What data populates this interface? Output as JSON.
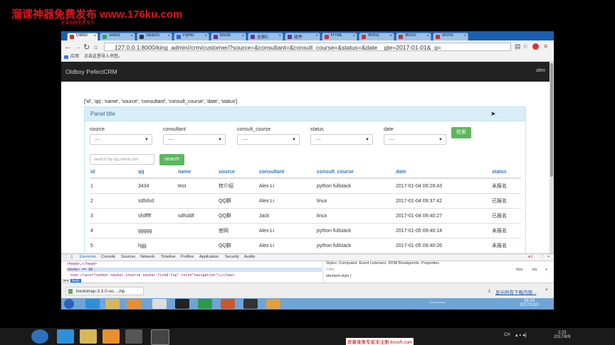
{
  "watermark": {
    "title": "溜课神器免费发布 www.176ku.com",
    "sub": "溜课神器免费发布"
  },
  "browser": {
    "tabs": [
      {
        "label": "Oldbo",
        "active": true
      },
      {
        "label": "select"
      },
      {
        "label": "Search"
      },
      {
        "label": "Pytho"
      },
      {
        "label": "Boots"
      },
      {
        "label": "全部C"
      },
      {
        "label": "组件"
      },
      {
        "label": "HTML"
      },
      {
        "label": "W3Sc"
      },
      {
        "label": "W3Sc"
      },
      {
        "label": "W3Sc"
      }
    ],
    "url": "127.0.0.1:8000/king_admin//crm/customer/?source=&consultant=&consult_course=&status=&date__gte=2017-01-01&_q=",
    "bookmarks": {
      "apps": "应用",
      "import": "点击这里导入书签。"
    }
  },
  "page": {
    "brand": "Oldboy PefectCRM",
    "user": "alex",
    "fields_line": "['id', 'qq', 'name', 'source', 'consultant', 'consult_course', 'date', 'status']",
    "panel_title": "Panel title",
    "filters": [
      {
        "label": "source",
        "value": "----"
      },
      {
        "label": "consultant",
        "value": "----"
      },
      {
        "label": "consult_course",
        "value": "----"
      },
      {
        "label": "status",
        "value": "----"
      },
      {
        "label": "date",
        "value": "----"
      }
    ],
    "filter_button": "检索",
    "search_placeholder": "search by qq,name,con",
    "search_button": "search",
    "table": {
      "headers": [
        "id",
        "qq",
        "name",
        "source",
        "consultant",
        "consult_course",
        "date",
        "status"
      ],
      "rows": [
        [
          "1",
          "3434",
          "test",
          "转介绍",
          "Alex Li",
          "python fullstack",
          "2017-01-04 09:29:43",
          "未报名"
        ],
        [
          "2",
          "sdfsfsd",
          "",
          "QQ群",
          "Alex Li",
          "linux",
          "2017-01-04 09:37:42",
          "已报名"
        ],
        [
          "3",
          "sfsfffff",
          "sdfsddf",
          "QQ群",
          "Jack",
          "linux",
          "2017-01-04 09:40:27",
          "已报名"
        ],
        [
          "4",
          "ggggg",
          "",
          "官网",
          "Alex Li",
          "python fullstack",
          "2017-01-05 09:40:14",
          "未报名"
        ],
        [
          "5",
          "hjjjjj",
          "",
          "QQ群",
          "Alex Li",
          "python fullstack",
          "2017-01-05 09:40:26",
          "未报名"
        ]
      ]
    }
  },
  "devtools": {
    "tabs": [
      "Elements",
      "Console",
      "Sources",
      "Network",
      "Timeline",
      "Profiles",
      "Application",
      "Security",
      "Audits"
    ],
    "style_tabs": [
      "Styles",
      "Computed",
      "Event Listeners",
      "DOM Breakpoints",
      "Properties"
    ],
    "lines": [
      "<head>…</head>",
      "<body> == $0",
      "<nav class=\"navbar navbar-inverse navbar-fixed-top\" role=\"navigation\">…</nav>"
    ],
    "breadcrumb": [
      "html",
      "body"
    ],
    "filter_placeholder": "Filter",
    "element_style": "element.style {",
    "hov": ":hov",
    "cls": ".cls",
    "errors": "1"
  },
  "download": {
    "file": "bootstrap-3.3.0-so....zip",
    "show_all": "显示所有下载内容..."
  },
  "inner_clock": {
    "time": "16:19",
    "date": "2017/1/10"
  },
  "outer_clock": {
    "time": "2:23",
    "date": "2017/6/9"
  },
  "tray_ch": "CH",
  "bottom_watermark": "屏幕录像专家未注册 tlxsoft.com"
}
